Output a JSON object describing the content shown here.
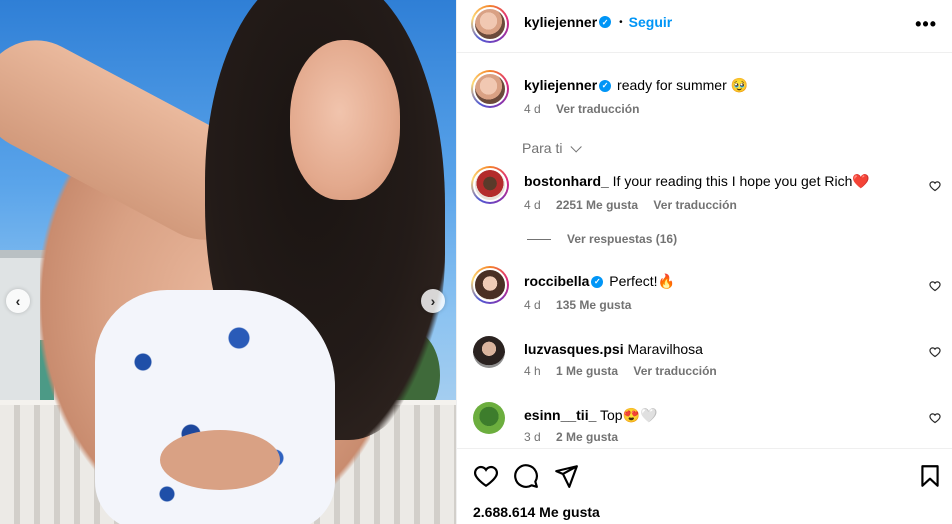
{
  "post": {
    "nav_prev_icon": "chevron-left-icon",
    "nav_next_icon": "chevron-right-icon"
  },
  "header": {
    "username": "kyliejenner",
    "separator": "•",
    "follow_label": "Seguir",
    "more_icon": "more-horizontal-icon"
  },
  "caption": {
    "username": "kyliejenner",
    "text": "ready for summer 🥹",
    "age": "4 d",
    "translate": "Ver traducción"
  },
  "filter": {
    "label": "Para ti"
  },
  "comments": [
    {
      "username": "bostonhard_",
      "text": "If your reading this I hope you get Rich❤️",
      "age": "4 d",
      "likes": "2251 Me gusta",
      "translate": "Ver traducción",
      "verified": false
    },
    {
      "username": "roccibella",
      "text": "Perfect!🔥",
      "age": "4 d",
      "likes": "135 Me gusta",
      "translate": "",
      "verified": true
    },
    {
      "username": "luzvasques.psi",
      "text": "Maravilhosa",
      "age": "4 h",
      "likes": "1 Me gusta",
      "translate": "Ver traducción",
      "verified": false
    },
    {
      "username": "esinn__tii_",
      "text": "Top😍🤍",
      "age": "3 d",
      "likes": "2 Me gusta",
      "translate": "",
      "verified": false
    }
  ],
  "replies": {
    "label": "Ver respuestas (16)"
  },
  "actions": {
    "like_icon": "heart-icon",
    "comment_icon": "comment-icon",
    "share_icon": "send-icon",
    "save_icon": "bookmark-icon",
    "likes_count": "2.688.614 Me gusta"
  },
  "colors": {
    "accent": "#0095f6",
    "muted": "#737373",
    "border": "#efefef"
  }
}
